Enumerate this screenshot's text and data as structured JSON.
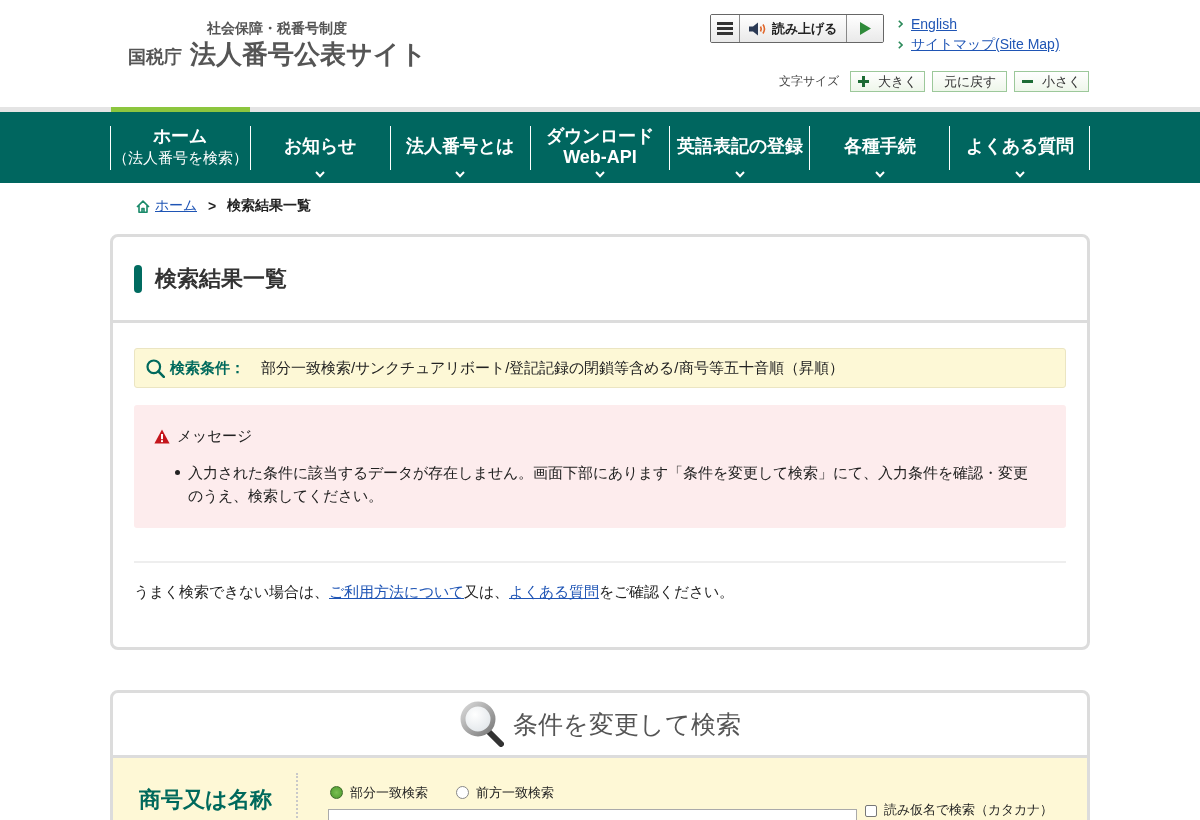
{
  "header": {
    "logo": {
      "subtitle": "社会保障・税番号制度",
      "agency": "国税庁",
      "title": "法人番号公表サイト"
    },
    "read_aloud": {
      "label": "読み上げる"
    },
    "links": [
      "English",
      "サイトマップ(Site Map)"
    ],
    "font_size": {
      "label": "文字サイズ",
      "buttons": [
        {
          "label": "大きく",
          "kind": "larger"
        },
        {
          "label": "元に戻す",
          "kind": "reset"
        },
        {
          "label": "小さく",
          "kind": "smaller"
        }
      ]
    }
  },
  "nav": [
    {
      "lines": [
        {
          "text": "ホーム",
          "kind": "main"
        },
        {
          "text": "（法人番号を検索）",
          "kind": "sub"
        }
      ],
      "selected": true,
      "has_submenu": false
    },
    {
      "lines": [
        {
          "text": "お知らせ",
          "kind": "main"
        }
      ],
      "selected": false,
      "has_submenu": true
    },
    {
      "lines": [
        {
          "text": "法人番号とは",
          "kind": "main"
        }
      ],
      "selected": false,
      "has_submenu": true
    },
    {
      "lines": [
        {
          "text": "ダウンロード",
          "kind": "main"
        },
        {
          "text": "Web-API",
          "kind": "main"
        }
      ],
      "selected": false,
      "has_submenu": true
    },
    {
      "lines": [
        {
          "text": "英語表記の登録",
          "kind": "main"
        }
      ],
      "selected": false,
      "has_submenu": true
    },
    {
      "lines": [
        {
          "text": "各種手続",
          "kind": "main"
        }
      ],
      "selected": false,
      "has_submenu": true
    },
    {
      "lines": [
        {
          "text": "よくある質問",
          "kind": "main"
        }
      ],
      "selected": false,
      "has_submenu": true
    }
  ],
  "breadcrumb": {
    "separator": ">",
    "items": [
      {
        "label": "ホーム",
        "kind": "home"
      },
      {
        "label": "検索結果一覧",
        "kind": "current"
      }
    ]
  },
  "results": {
    "title": "検索結果一覧",
    "conditions": {
      "label": "検索条件：",
      "value": "部分一致検索/サンクチュアリボート/登記記録の閉鎖等含める/商号等五十音順（昇順）"
    },
    "message": {
      "title": "メッセージ",
      "items": [
        "入力された条件に該当するデータが存在しません。画面下部にあります「条件を変更して検索」にて、入力条件を確認・変更のうえ、検索してください。"
      ]
    },
    "help": [
      {
        "kind": "text",
        "text": "うまく検索できない場合は、"
      },
      {
        "kind": "link",
        "text": "ご利用方法について"
      },
      {
        "kind": "text",
        "text": "又は、"
      },
      {
        "kind": "link",
        "text": "よくある質問"
      },
      {
        "kind": "text",
        "text": "をご確認ください。"
      }
    ]
  },
  "search_form": {
    "title": "条件を変更して検索",
    "fields": [
      {
        "label": "商号又は名称",
        "match_options": [
          {
            "label": "部分一致検索",
            "selected": true
          },
          {
            "label": "前方一致検索",
            "selected": false
          }
        ],
        "kana_search": {
          "label": "読み仮名で検索（カタカナ）",
          "checked": false
        }
      }
    ]
  }
}
